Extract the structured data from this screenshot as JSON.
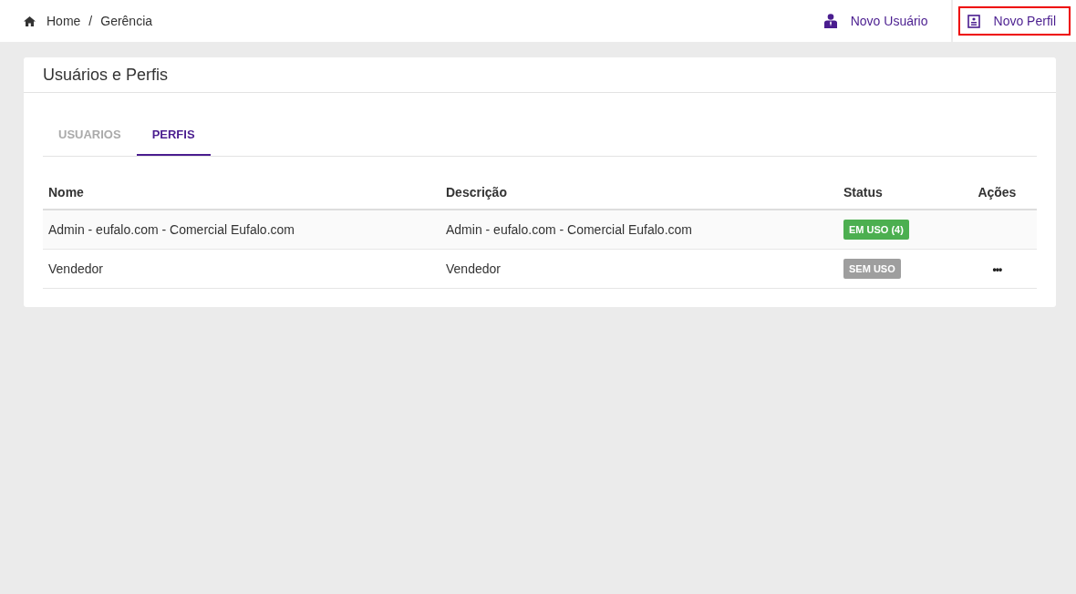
{
  "breadcrumb": [
    {
      "label": "Home",
      "kind": "home"
    },
    {
      "label": "Gerência",
      "kind": "text"
    }
  ],
  "breadcrumb_separator": "/",
  "actions": [
    {
      "label": "Novo Usuário",
      "kind": "user",
      "highlighted": false
    },
    {
      "label": "Novo Perfil",
      "kind": "profile",
      "highlighted": true
    }
  ],
  "card": {
    "title": "Usuários e Perfis"
  },
  "tabs": [
    {
      "label": "USUARIOS",
      "selected": false
    },
    {
      "label": "PERFIS",
      "selected": true
    }
  ],
  "table": {
    "columns": [
      "Nome",
      "Descrição",
      "Status",
      "Ações"
    ],
    "rows": [
      {
        "name": "Admin - eufalo.com - Comercial Eufalo.com",
        "description": "Admin - eufalo.com - Comercial Eufalo.com",
        "status": "EM USO (4)",
        "color": "#4caf50"
      },
      {
        "name": "Vendedor",
        "description": "Vendedor",
        "status": "SEM USO",
        "color": "#9e9e9e",
        "menu": "•••"
      }
    ]
  }
}
